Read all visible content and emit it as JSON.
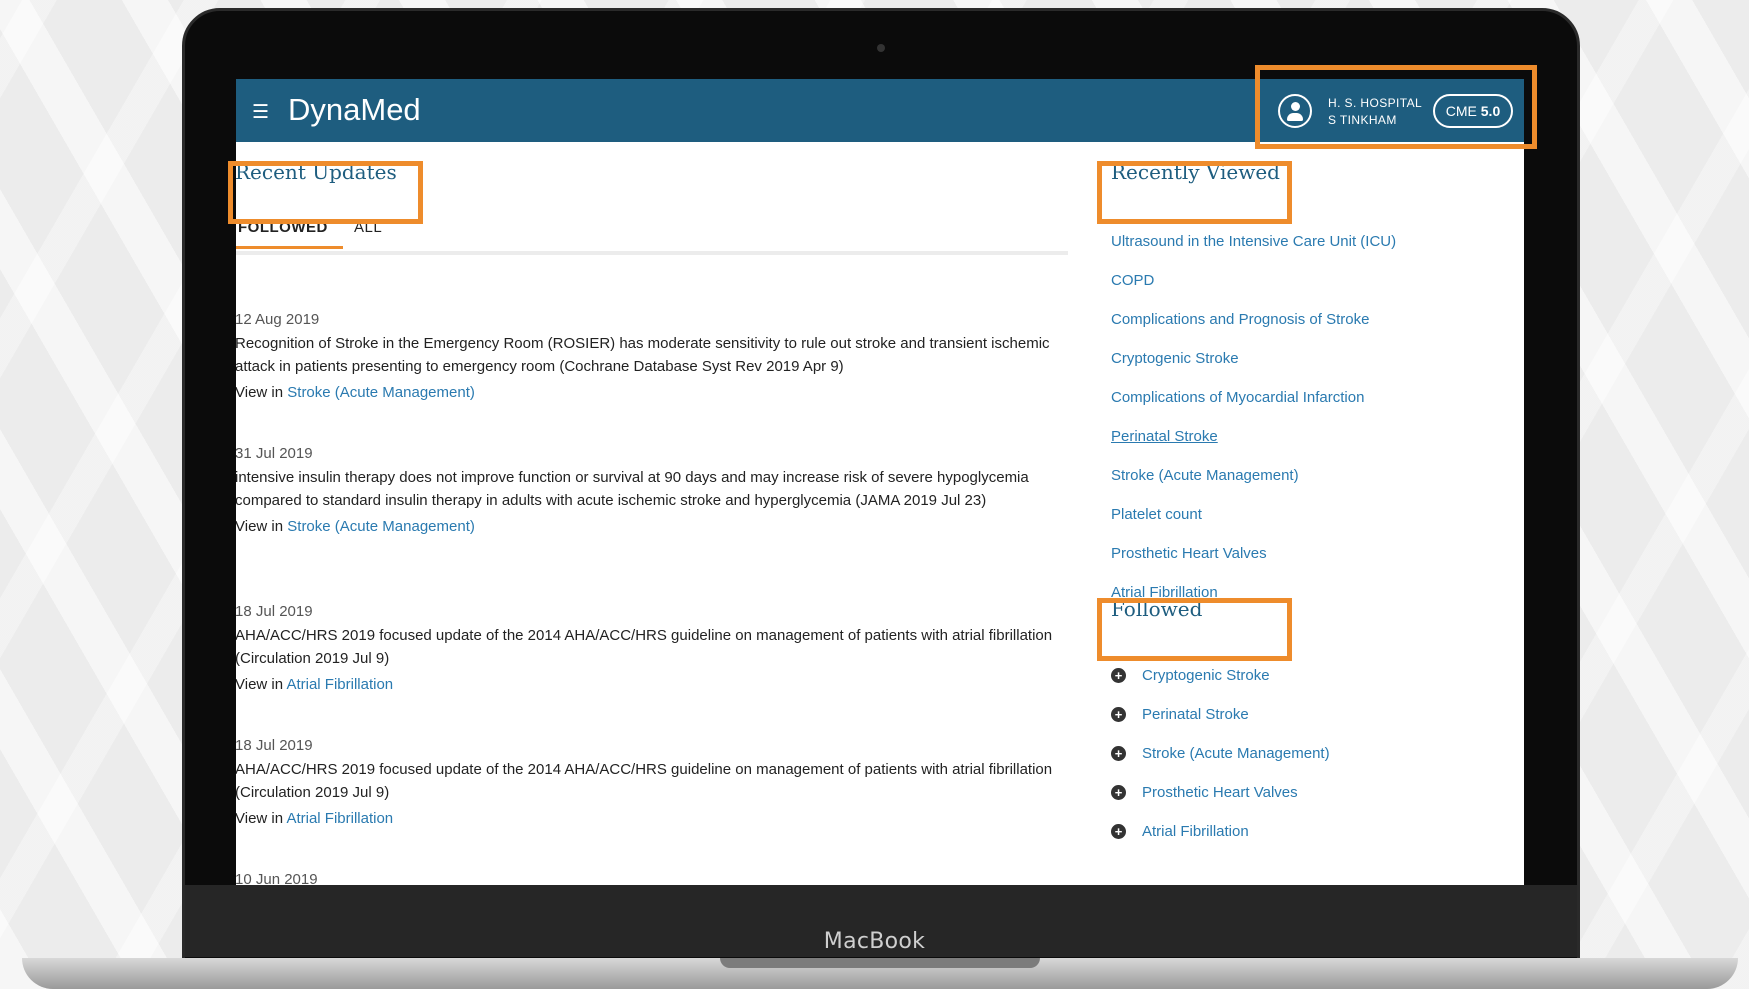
{
  "device_label": "MacBook",
  "app": {
    "brand": "DynaMed",
    "menu_icon": "hamburger-icon",
    "org_line1": "H. S. HOSPITAL",
    "org_line2": "S TINKHAM",
    "cme_label": "CME",
    "cme_value": "5.0",
    "user_icon": "user-icon"
  },
  "recent_updates": {
    "title": "Recent Updates",
    "tabs": [
      {
        "label": "FOLLOWED",
        "active": true
      },
      {
        "label": "ALL",
        "active": false
      }
    ],
    "view_prefix": "View in",
    "items": [
      {
        "date": "12 Aug 2019",
        "text": "Recognition of Stroke in the Emergency Room (ROSIER) has moderate sensitivity to rule out stroke and transient ischemic attack in patients presenting to emergency room (Cochrane Database Syst Rev 2019 Apr 9)",
        "link": "Stroke (Acute Management)"
      },
      {
        "date": "31 Jul 2019",
        "text": "intensive insulin therapy does not improve function or survival at 90 days and may increase risk of severe hypoglycemia compared to standard insulin therapy in adults with acute ischemic stroke and hyperglycemia (JAMA 2019 Jul 23)",
        "link": "Stroke (Acute Management)"
      },
      {
        "date": "18 Jul 2019",
        "text": "AHA/ACC/HRS 2019 focused update of the 2014 AHA/ACC/HRS guideline on management of patients with atrial fibrillation (Circulation 2019 Jul 9)",
        "link": "Atrial Fibrillation"
      },
      {
        "date": "18 Jul 2019",
        "text": "AHA/ACC/HRS 2019 focused update of the 2014 AHA/ACC/HRS guideline on management of patients with atrial fibrillation (Circulation 2019 Jul 9)",
        "link": "Atrial Fibrillation"
      },
      {
        "date": "10 Jun 2019",
        "text": "",
        "link": ""
      }
    ]
  },
  "recently_viewed": {
    "title": "Recently Viewed",
    "items": [
      "Ultrasound in the Intensive Care Unit (ICU)",
      "COPD",
      "Complications and Prognosis of Stroke",
      "Cryptogenic Stroke",
      "Complications of Myocardial Infarction",
      "Perinatal Stroke",
      "Stroke (Acute Management)",
      "Platelet count",
      "Prosthetic Heart Valves",
      "Atrial Fibrillation"
    ]
  },
  "followed": {
    "title": "Followed",
    "icon": "plus-circle-icon",
    "items": [
      "Cryptogenic Stroke",
      "Perinatal Stroke",
      "Stroke (Acute Management)",
      "Prosthetic Heart Valves",
      "Atrial Fibrillation"
    ]
  },
  "colors": {
    "header_bg": "#1e5d7f",
    "link": "#2a7ab0",
    "highlight": "#ee8c2c",
    "title": "#1e5d7f"
  }
}
